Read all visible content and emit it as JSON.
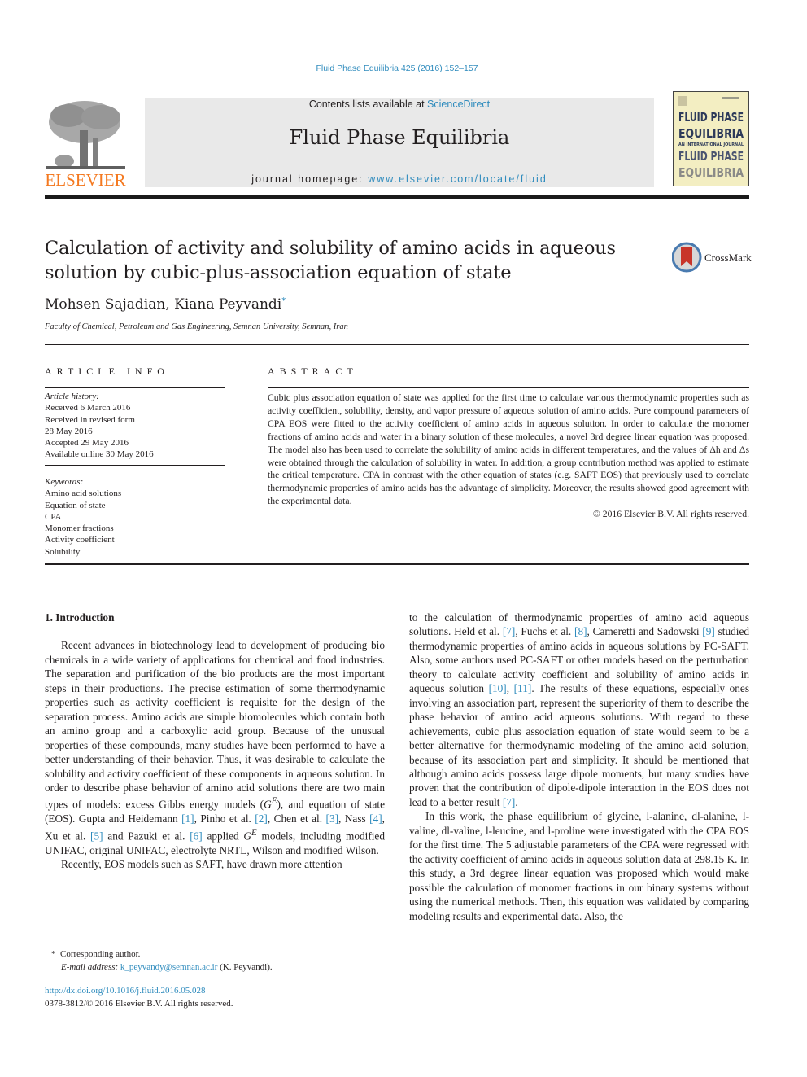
{
  "header": {
    "journal_ref": "Fluid Phase Equilibria 425 (2016) 152–157",
    "contents_prefix": "Contents lists available at ",
    "contents_link": "ScienceDirect",
    "journal_name": "Fluid Phase Equilibria",
    "homepage_prefix": "journal homepage: ",
    "homepage_link": "www.elsevier.com/locate/fluid",
    "publisher_logo_text": "ELSEVIER",
    "cover": {
      "line1": "FLUID PHASE",
      "line2": "EQUILIBRIA",
      "line3": "AN INTERNATIONAL JOURNAL",
      "line4": "FLUID PHASE",
      "line5": "EQUILIBRIA"
    },
    "colors": {
      "link": "#2e8bbd",
      "elsevier_orange": "#f47920",
      "banner_bg": "#e9e9e9",
      "cover_bg": "#f3eec2",
      "cover_ink": "#2d3a5a"
    }
  },
  "article": {
    "title": "Calculation of activity and solubility of amino acids in aqueous solution by cubic-plus-association equation of state",
    "crossmark_label": "CrossMark",
    "authors": "Mohsen Sajadian, Kiana Peyvandi",
    "author_mark": "*",
    "affiliation": "Faculty of Chemical, Petroleum and Gas Engineering, Semnan University, Semnan, Iran"
  },
  "article_info": {
    "heading": "ARTICLE INFO",
    "history_label": "Article history:",
    "history": [
      "Received 6 March 2016",
      "Received in revised form",
      "28 May 2016",
      "Accepted 29 May 2016",
      "Available online 30 May 2016"
    ],
    "keywords_label": "Keywords:",
    "keywords": [
      "Amino acid solutions",
      "Equation of state",
      "CPA",
      "Monomer fractions",
      "Activity coefficient",
      "Solubility"
    ]
  },
  "abstract": {
    "heading": "ABSTRACT",
    "text": "Cubic plus association equation of state was applied for the first time to calculate various thermodynamic properties such as activity coefficient, solubility, density, and vapor pressure of aqueous solution of amino acids. Pure compound parameters of CPA EOS were fitted to the activity coefficient of amino acids in aqueous solution. In order to calculate the monomer fractions of amino acids and water in a binary solution of these molecules, a novel 3rd degree linear equation was proposed. The model also has been used to correlate the solubility of amino acids in different temperatures, and the values of Δh and Δs were obtained through the calculation of solubility in water. In addition, a group contribution method was applied to estimate the critical temperature. CPA in contrast with the other equation of states (e.g. SAFT EOS) that previously used to correlate thermodynamic properties of amino acids has the advantage of simplicity. Moreover, the results showed good agreement with the experimental data.",
    "copyright": "© 2016 Elsevier B.V. All rights reserved."
  },
  "body": {
    "section_heading": "1.  Introduction",
    "left": {
      "p1": "Recent advances in biotechnology lead to development of producing bio chemicals in a wide variety of applications for chemical and food industries. The separation and purification of the bio products are the most important steps in their productions. The precise estimation of some thermodynamic properties such as activity coefficient is requisite for the design of the separation process. Amino acids are simple biomolecules which contain both an amino group and a carboxylic acid group. Because of the unusual properties of these compounds, many studies have been performed to have a better understanding of their behavior. Thus, it was desirable to calculate the solubility and activity coefficient of these components in aqueous solution. In order to describe phase behavior of amino acid solutions there are two main types of models: excess Gibbs energy models (",
      "ge_symbol": "G",
      "ge_sup": "E",
      "p1b": "), and equation of state (EOS). Gupta and Heidemann ",
      "c1": "[1]",
      "t1": ", Pinho et al. ",
      "c2": "[2]",
      "t2": ", Chen et al. ",
      "c3": "[3]",
      "t3": ", Nass ",
      "c4": "[4]",
      "t4": ", Xu et al. ",
      "c5": "[5]",
      "t5": " and Pazuki et al. ",
      "c6": "[6]",
      "t6": " applied ",
      "t7": " models, including modified UNIFAC, original UNIFAC, electrolyte NRTL, Wilson and modified Wilson.",
      "p2": "Recently, EOS models such as SAFT, have drawn more attention"
    },
    "right": {
      "a0": "to the calculation of thermodynamic properties of amino acid aqueous solutions. Held et al. ",
      "c7": "[7]",
      "a1": ", Fuchs et al. ",
      "c8": "[8]",
      "a2": ", Cameretti and Sadowski ",
      "c9": "[9]",
      "a3": " studied thermodynamic properties of amino acids in aqueous solutions by PC-SAFT. Also, some authors used PC-SAFT or other models based on the perturbation theory to calculate activity coefficient and solubility of amino acids in aqueous solution ",
      "c10": "[10]",
      "a4": ", ",
      "c11": "[11]",
      "a5": ". The results of these equations, especially ones involving an association part, represent the superiority of them to describe the phase behavior of amino acid aqueous solutions. With regard to these achievements, cubic plus association equation of state would seem to be a better alternative for thermodynamic modeling of the amino acid solution, because of its association part and simplicity. It should be mentioned that although amino acids possess large dipole moments, but many studies have proven that the contribution of dipole-dipole interaction in the EOS does not lead to a better result ",
      "c7b": "[7]",
      "a6": ".",
      "p2": "In this work, the phase equilibrium of glycine, l-alanine, dl-alanine, l-valine, dl-valine, l-leucine, and l-proline were investigated with the CPA EOS for the first time. The 5 adjustable parameters of the CPA were regressed with the activity coefficient of amino acids in aqueous solution data at 298.15 K. In this study, a 3rd degree linear equation was proposed which would make possible the calculation of monomer fractions in our binary systems without using the numerical methods. Then, this equation was validated by comparing modeling results and experimental data. Also, the"
    }
  },
  "footnote": {
    "mark": "*",
    "corresponding": "Corresponding author.",
    "email_label": "E-mail address: ",
    "email": "k_peyvandy@semnan.ac.ir",
    "email_suffix": " (K. Peyvandi)."
  },
  "footer": {
    "doi": "http://dx.doi.org/10.1016/j.fluid.2016.05.028",
    "issn_line": "0378-3812/© 2016 Elsevier B.V. All rights reserved."
  }
}
